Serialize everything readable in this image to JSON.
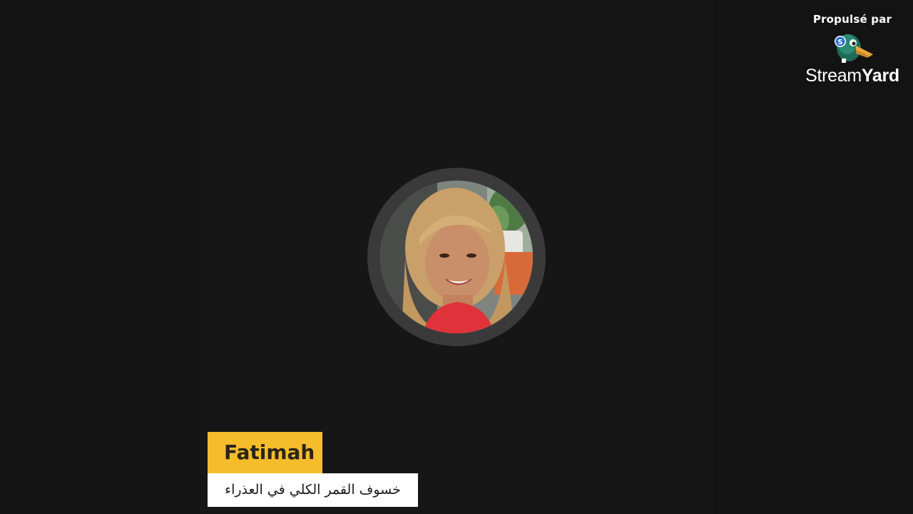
{
  "branding": {
    "powered_by": "Propulsé par",
    "brand_part1": "Stream",
    "brand_part2": "Yard",
    "logo_icon": "streamyard-duck-icon"
  },
  "participant": {
    "name": "Fatimah",
    "avatar_icon": "participant-avatar",
    "subtitle": "خسوف القمر الكلي في العذراء"
  },
  "colors": {
    "background": "#131313",
    "name_tag": "#f5bd2b",
    "subtitle_tag": "#ffffff",
    "avatar_ring": "#3a3a3a"
  }
}
